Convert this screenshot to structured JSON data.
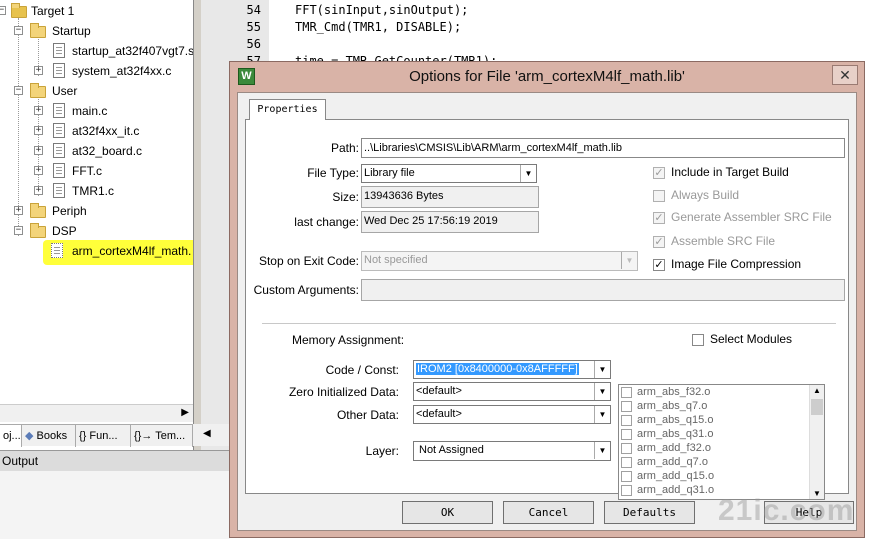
{
  "tree": {
    "items": [
      {
        "label": "Target 1",
        "type": "target"
      },
      {
        "label": "Startup",
        "type": "folder"
      },
      {
        "label": "startup_at32f407vgt7.s",
        "type": "file"
      },
      {
        "label": "system_at32f4xx.c",
        "type": "file"
      },
      {
        "label": "User",
        "type": "folder"
      },
      {
        "label": "main.c",
        "type": "file"
      },
      {
        "label": "at32f4xx_it.c",
        "type": "file"
      },
      {
        "label": "at32_board.c",
        "type": "file"
      },
      {
        "label": "FFT.c",
        "type": "file"
      },
      {
        "label": "TMR1.c",
        "type": "file"
      },
      {
        "label": "Periph",
        "type": "folder"
      },
      {
        "label": "DSP",
        "type": "folder"
      },
      {
        "label": "arm_cortexM4lf_math.",
        "type": "lib",
        "selected": true
      }
    ],
    "highlight_color": "#ffff3a"
  },
  "tabs": [
    {
      "label": "oj..."
    },
    {
      "label": "Books"
    },
    {
      "label": "{} Fun..."
    },
    {
      "label": "{}→ Tem..."
    }
  ],
  "output_label": "Output",
  "code": {
    "lines": [
      {
        "num": "54",
        "text": "FFT(sinInput,sinOutput);"
      },
      {
        "num": "55",
        "text": "TMR_Cmd(TMR1, DISABLE);"
      },
      {
        "num": "56",
        "text": ""
      },
      {
        "num": "57",
        "text": "time = TMR_GetCounter(TMR1);"
      }
    ]
  },
  "dialog": {
    "title": "Options for File 'arm_cortexM4lf_math.lib'",
    "icon": "keil-uvision-icon",
    "close": "✕",
    "tab": "Properties",
    "path_label": "Path:",
    "path_value": "..\\Libraries\\CMSIS\\Lib\\ARM\\arm_cortexM4lf_math.lib",
    "filetype_label": "File Type:",
    "filetype_value": "Library file",
    "size_label": "Size:",
    "size_value": "13943636 Bytes",
    "lastchange_label": "last change:",
    "lastchange_value": "Wed Dec 25 17:56:19 2019",
    "stop_label": "Stop on Exit Code:",
    "stop_value": "Not specified",
    "custom_label": "Custom Arguments:",
    "custom_value": "",
    "options": [
      {
        "label": "Include in Target Build",
        "checked": true,
        "enabled": false
      },
      {
        "label": "Always Build",
        "checked": false,
        "enabled": false
      },
      {
        "label": "Generate Assembler SRC File",
        "checked": true,
        "enabled": false
      },
      {
        "label": "Assemble SRC File",
        "checked": true,
        "enabled": false
      },
      {
        "label": "Image File Compression",
        "checked": true,
        "enabled": true
      }
    ],
    "memory_label": "Memory Assignment:",
    "select_modules_label": "Select Modules",
    "code_const_label": "Code / Const:",
    "code_const_value": "IROM2 [0x8400000-0x8AFFFFF]",
    "zero_init_label": "Zero Initialized Data:",
    "zero_init_value": "<default>",
    "other_data_label": "Other Data:",
    "other_data_value": "<default>",
    "layer_label": "Layer:",
    "layer_value": "Not Assigned",
    "modules": [
      "arm_abs_f32.o",
      "arm_abs_q7.o",
      "arm_abs_q15.o",
      "arm_abs_q31.o",
      "arm_add_f32.o",
      "arm_add_q7.o",
      "arm_add_q15.o",
      "arm_add_q31.o"
    ],
    "buttons": {
      "ok": "OK",
      "cancel": "Cancel",
      "defaults": "Defaults",
      "help": "Help"
    }
  },
  "watermark": "21ic.com",
  "colors": {
    "selection": "#3399ff",
    "dialog_frame": "#d9b3a7"
  }
}
